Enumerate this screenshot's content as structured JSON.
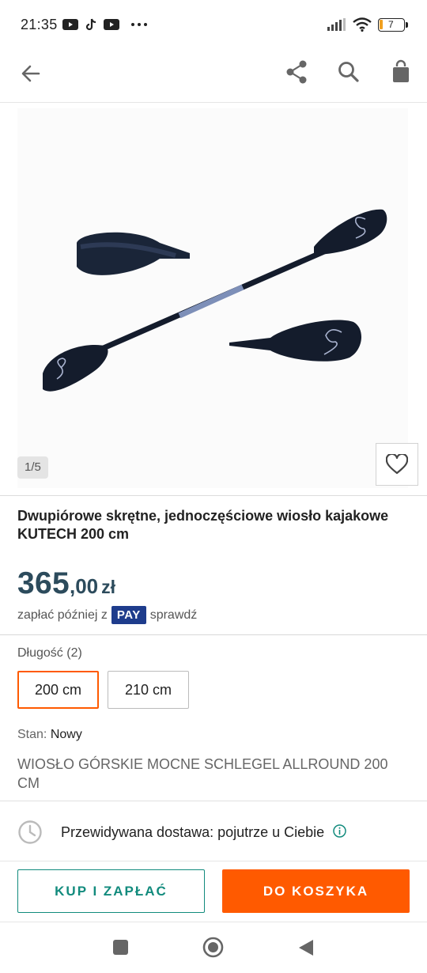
{
  "status_bar": {
    "time": "21:35",
    "left_icons": [
      "youtube-icon",
      "tiktok-icon",
      "youtube-icon",
      "more-dots-icon"
    ],
    "right_icons": [
      "signal-icon",
      "wifi-icon",
      "battery-icon"
    ],
    "battery": "7"
  },
  "app_bar": {
    "icons": [
      "back-arrow-icon",
      "share-icon",
      "search-icon",
      "shopping-bag-icon"
    ]
  },
  "gallery": {
    "counter": "1/5"
  },
  "product": {
    "title": "Dwupiórowe skrętne, jednoczęściowe wiosło kajakowe KUTECH 200 cm",
    "price_main": "365",
    "price_cents": ",00",
    "currency": "zł",
    "pay_later_prefix": "zapłać później z",
    "pay_badge": "PAY",
    "pay_later_suffix": "sprawdź"
  },
  "variants": {
    "label": "Długość (2)",
    "options": [
      "200 cm",
      "210 cm"
    ],
    "selected": "200 cm"
  },
  "condition": {
    "label": "Stan:",
    "value": "Nowy"
  },
  "subtitle": "WIOSŁO GÓRSKIE MOCNE SCHLEGEL ALLROUND 200 CM",
  "delivery": {
    "text": "Przewidywana dostawa: pojutrze u Ciebie"
  },
  "actions": {
    "buy_now": "KUP I ZAPŁAĆ",
    "add_to_cart": "DO KOSZYKA"
  },
  "colors": {
    "accent_orange": "#ff5a00",
    "accent_teal": "#128b7d",
    "price_color": "#2c4b5c",
    "pay_badge_bg": "#1e3c8c"
  }
}
